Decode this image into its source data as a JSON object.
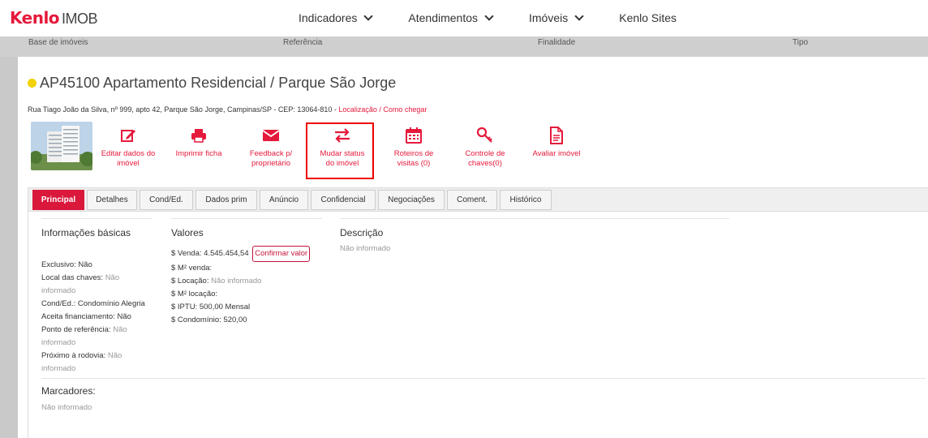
{
  "header": {
    "logo_brand": "Kenlo",
    "logo_product": "IMOB",
    "nav": [
      {
        "label": "Indicadores"
      },
      {
        "label": "Atendimentos"
      },
      {
        "label": "Imóveis"
      },
      {
        "label": "Kenlo Sites"
      }
    ]
  },
  "filters": {
    "base": "Base de imóveis",
    "referencia": "Referência",
    "finalidade": "Finalidade",
    "tipo": "Tipo"
  },
  "property": {
    "status_color": "#f2d200",
    "title": "AP45100 Apartamento Residencial / Parque São Jorge",
    "address": "Rua Tiago João da Silva, nº 999, apto 42, Parque São Jorge, Campinas/SP - CEP: 13064-810 -",
    "location_link": "Localização / Como chegar"
  },
  "actions": [
    {
      "label1": "Editar dados do",
      "label2": "imóvel",
      "icon": "edit-icon"
    },
    {
      "label1": "Imprimir ficha",
      "label2": "",
      "icon": "printer-icon"
    },
    {
      "label1": "Feedback p/",
      "label2": "proprietário",
      "icon": "mail-icon"
    },
    {
      "label1": "Mudar status",
      "label2": "do imóvel",
      "icon": "swap-arrows-icon"
    },
    {
      "label1": "Roteiros de",
      "label2": "visitas (0)",
      "icon": "calendar-icon"
    },
    {
      "label1": "Controle de",
      "label2": "chaves(0)",
      "icon": "key-icon"
    },
    {
      "label1": "Avaliar imóvel",
      "label2": "",
      "icon": "document-icon"
    }
  ],
  "tabs": [
    {
      "label": "Principal"
    },
    {
      "label": "Detalhes"
    },
    {
      "label": "Cond/Ed."
    },
    {
      "label": "Dados prim"
    },
    {
      "label": "Anúncio"
    },
    {
      "label": "Confidencial"
    },
    {
      "label": "Negociações"
    },
    {
      "label": "Coment."
    },
    {
      "label": "Histórico"
    }
  ],
  "basic_info": {
    "title": "Informações básicas",
    "exclusivo_label": "Exclusivo:",
    "exclusivo_value": "Não",
    "local_chaves_label": "Local das chaves:",
    "local_chaves_value": "Não informado",
    "cond_label": "Cond/Ed.:",
    "cond_value": "Condomínio Alegria",
    "aceita_label": "Aceita financiamento:",
    "aceita_value": "Não",
    "ponto_label": "Ponto de referência:",
    "ponto_value": "Não informado",
    "proximo_label": "Próximo à rodovia:",
    "proximo_value": "Não informado"
  },
  "values": {
    "title": "Valores",
    "venda_label": "$ Venda:",
    "venda_value": "4.545.454,54",
    "confirm_button": "Confirmar valor",
    "m2_venda_label": "$ M² venda:",
    "locacao_label": "$ Locação:",
    "locacao_value": "Não informado",
    "m2_locacao_label": "$ M² locação:",
    "iptu_label": "$ IPTU:",
    "iptu_value": "500,00 Mensal",
    "condominio_label": "$ Condomínio:",
    "condominio_value": "520,00"
  },
  "description": {
    "title": "Descrição",
    "value": "Não informado"
  },
  "markers": {
    "title": "Marcadores:",
    "value": "Não informado"
  }
}
